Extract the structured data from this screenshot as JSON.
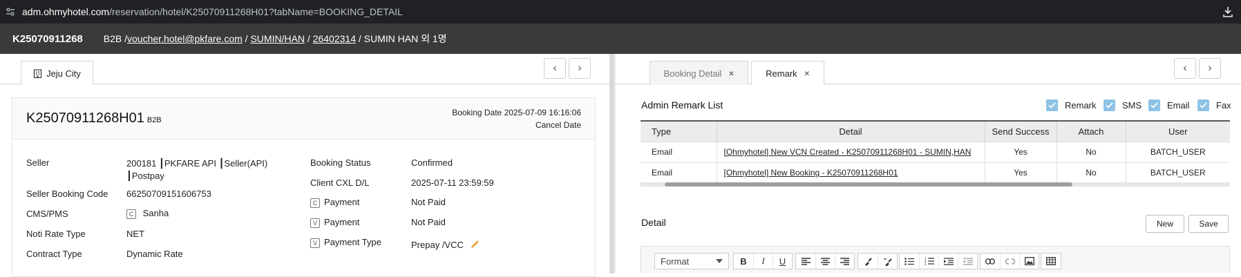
{
  "browser": {
    "url_host": "adm.ohmyhotel.com",
    "url_path": "/reservation/hotel/K25070911268H01?tabName=BOOKING_DETAIL"
  },
  "header": {
    "reservation_no": "K25070911268",
    "channel": "B2B /",
    "email": "voucher.hotel@pkfare.com",
    "sep1": " / ",
    "guest_code": "SUMIN/HAN",
    "sep2": " / ",
    "member_id": "26402314",
    "guest_name": " / SUMIN HAN 외 1명"
  },
  "left": {
    "tab_label": "Jeju City",
    "card": {
      "booking_id": "K25070911268H01",
      "booking_type": "B2B",
      "booking_date": "Booking Date 2025-07-09 16:16:06",
      "cancel_date": "Cancel Date"
    },
    "fields": {
      "seller_label": "Seller",
      "seller_value_1": "200181 ┃PKFARE API ┃Seller(API)",
      "seller_value_2": "┃Postpay",
      "seller_code_label": "Seller Booking Code",
      "seller_code_value": "66250709151606753",
      "cms_label": "CMS/PMS",
      "cms_box": "C",
      "cms_value": "Sanha",
      "noti_label": "Noti Rate Type",
      "noti_value": "NET",
      "contract_label": "Contract Type",
      "contract_value": "Dynamic Rate",
      "status_label": "Booking Status",
      "status_value": "Confirmed",
      "cxl_label": "Client CXL D/L",
      "cxl_value": "2025-07-11 23:59:59",
      "payment_c_box": "C",
      "payment_c_label": "Payment",
      "payment_c_value": "Not Paid",
      "payment_v_box": "V",
      "payment_v_label": "Payment",
      "payment_v_value": "Not Paid",
      "ptype_box": "V",
      "ptype_label": "Payment Type",
      "ptype_value": "Prepay /VCC"
    }
  },
  "right": {
    "tabs": [
      {
        "label": "Booking Detail"
      },
      {
        "label": "Remark"
      }
    ],
    "remark_title": "Admin Remark List",
    "filters": [
      {
        "label": "Remark"
      },
      {
        "label": "SMS"
      },
      {
        "label": "Email"
      },
      {
        "label": "Fax"
      }
    ],
    "table": {
      "headers": [
        "Type",
        "Detail",
        "Send Success",
        "Attach",
        "User"
      ],
      "rows": [
        {
          "type": "Email",
          "detail": "[Ohmyhotel] New VCN Created - K25070911268H01 - SUMIN,HAN",
          "success": "Yes",
          "attach": "No",
          "user": "BATCH_USER"
        },
        {
          "type": "Email",
          "detail": "[Ohmyhotel] New Booking - K25070911268H01",
          "success": "Yes",
          "attach": "No",
          "user": "BATCH_USER"
        }
      ]
    },
    "detail_title": "Detail",
    "new_label": "New",
    "save_label": "Save",
    "editor": {
      "format_label": "Format",
      "bold": "B",
      "italic": "I",
      "underline": "U"
    }
  },
  "colors": {
    "header_bg": "#3a3a3a",
    "browser_bg": "#202124",
    "checkbox": "#8ec3e6",
    "edit_icon": "#f0a030"
  }
}
